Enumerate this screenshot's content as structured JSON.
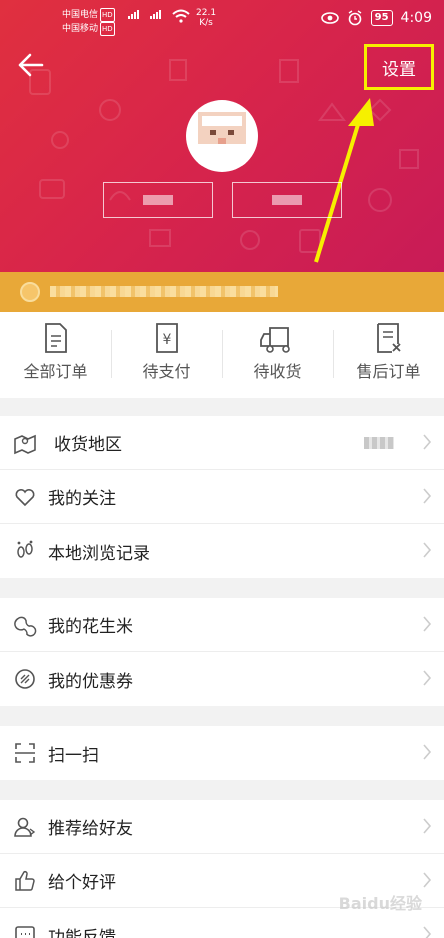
{
  "status": {
    "carrier1": "中国电信",
    "carrier2": "中国移动",
    "carrier_badge": "HD",
    "speed": "22.1",
    "speed_unit": "K/s",
    "battery": "95",
    "time": "4:09"
  },
  "header": {
    "settings_label": "设置",
    "accent_color": "#d8254a",
    "highlight_color": "#f6f000"
  },
  "orders": [
    {
      "label": "全部订单",
      "icon": "order-list-icon"
    },
    {
      "label": "待支付",
      "icon": "pending-payment-icon"
    },
    {
      "label": "待收货",
      "icon": "delivery-truck-icon"
    },
    {
      "label": "售后订单",
      "icon": "after-sales-icon"
    }
  ],
  "menu": {
    "region_label": "收货地区",
    "follow_label": "我的关注",
    "history_label": "本地浏览记录",
    "peanuts_label": "我的花生米",
    "coupons_label": "我的优惠券",
    "scan_label": "扫一扫",
    "recommend_label": "推荐给好友",
    "rate_label": "给个好评",
    "feedback_label": "功能反馈"
  },
  "watermark": "Baidu经验"
}
